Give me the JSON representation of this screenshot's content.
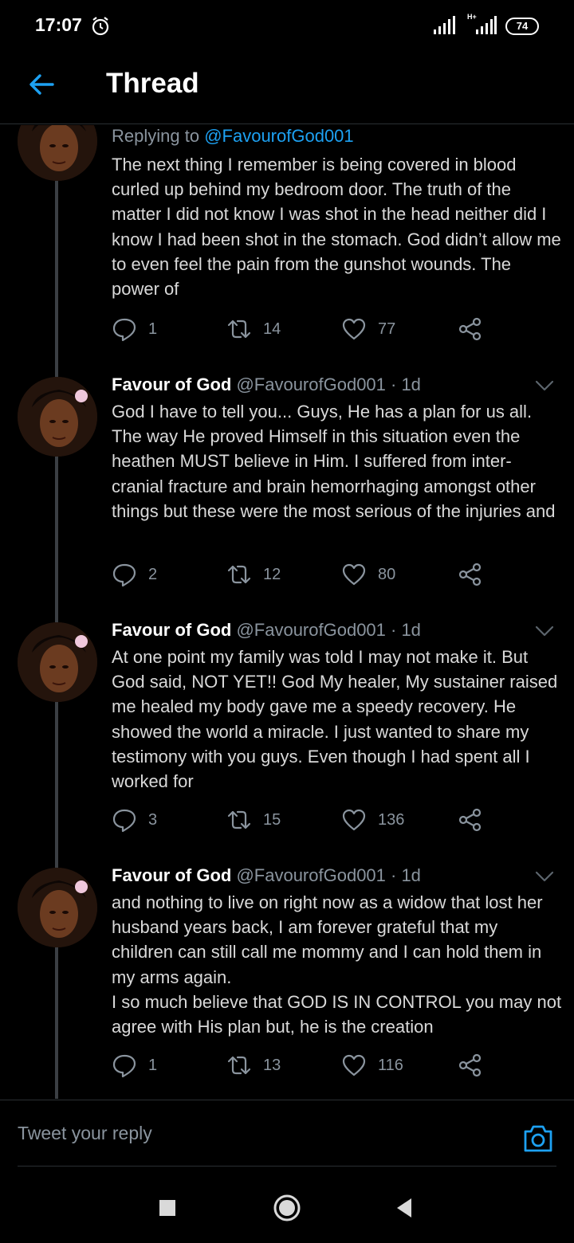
{
  "status_bar": {
    "time": "17:07",
    "network": "H+",
    "battery": "74"
  },
  "header": {
    "title": "Thread"
  },
  "colors": {
    "background": "#000000",
    "accent": "#1da1f2",
    "secondary_text": "#8a949e",
    "primary_text": "#d9d9d9"
  },
  "tweets": [
    {
      "replying_prefix": "Replying to",
      "replying_handle": "@FavourofGod001",
      "text": "The next thing I remember is being covered in blood curled up behind my bedroom door. The truth of the matter I did not know I was shot in the head neither did I know I had been shot in the stomach. God didn’t allow me to even feel the pain from the gunshot wounds. The power of",
      "replies": "1",
      "retweets": "14",
      "likes": "77"
    },
    {
      "name": "Favour of God",
      "handle_time": "@FavourofGod001 · 1d",
      "text": "God I have to tell you... Guys, He has a plan for us all. The way He proved Himself in this situation even the heathen MUST believe in Him. I suffered from inter-cranial fracture and brain hemorrhaging amongst other things but these were the most serious of the injuries and",
      "replies": "2",
      "retweets": "12",
      "likes": "80"
    },
    {
      "name": "Favour of God",
      "handle_time": "@FavourofGod001 · 1d",
      "text": "At one point my family was told I may not make it. But God said, NOT YET!! God My healer, My sustainer raised me healed my body gave me a speedy recovery. He showed the world a miracle. I just wanted to share my testimony with you guys. Even though I had spent all I worked for",
      "replies": "3",
      "retweets": "15",
      "likes": "136"
    },
    {
      "name": "Favour of God",
      "handle_time": "@FavourofGod001 · 1d",
      "text": "and nothing to live on right now as a widow that lost her husband years back, I am forever grateful that my children can still call me mommy and I can hold them in my arms again.\nI so much believe that GOD IS IN CONTROL you may not agree with His plan but, he is the creation",
      "replies": "1",
      "retweets": "13",
      "likes": "116"
    }
  ],
  "reply_bar": {
    "placeholder": "Tweet your reply"
  },
  "icons": [
    "alarm-icon",
    "signal-icon",
    "battery-icon",
    "back-arrow-icon",
    "avatar",
    "caret-down-icon",
    "reply-icon",
    "retweet-icon",
    "like-icon",
    "share-icon",
    "camera-icon",
    "recents-icon",
    "home-icon",
    "back-icon"
  ]
}
